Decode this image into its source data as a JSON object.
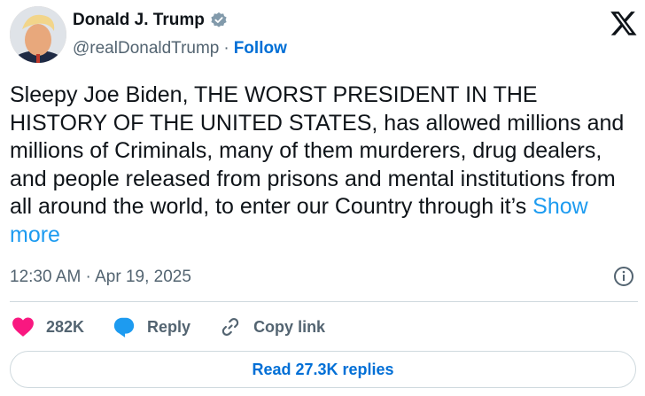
{
  "author": {
    "name": "Donald J. Trump",
    "handle": "@realDonaldTrump",
    "separator": "·",
    "follow_label": "Follow"
  },
  "tweet": {
    "text": "Sleepy Joe Biden, THE WORST PRESIDENT IN THE HISTORY OF THE UNITED STATES, has allowed millions and millions of Criminals, many of them murderers, drug dealers, and people released from prisons and mental institutions from all around the world, to enter our Country through it’s",
    "show_more": "Show more",
    "timestamp": "12:30 AM · Apr 19, 2025"
  },
  "actions": {
    "like_count": "282K",
    "reply_label": "Reply",
    "copy_link_label": "Copy link"
  },
  "read_replies_label": "Read 27.3K replies",
  "icons": [
    "verified-badge-icon",
    "x-logo-icon",
    "info-icon",
    "heart-icon",
    "reply-bubble-icon",
    "link-icon"
  ],
  "colors": {
    "text": "#0f1419",
    "secondary": "#536471",
    "link": "#1d9bf0",
    "follow": "#006fd6",
    "heart": "#f91880",
    "reply_icon": "#1d9bf0",
    "border": "#cfd9de"
  }
}
